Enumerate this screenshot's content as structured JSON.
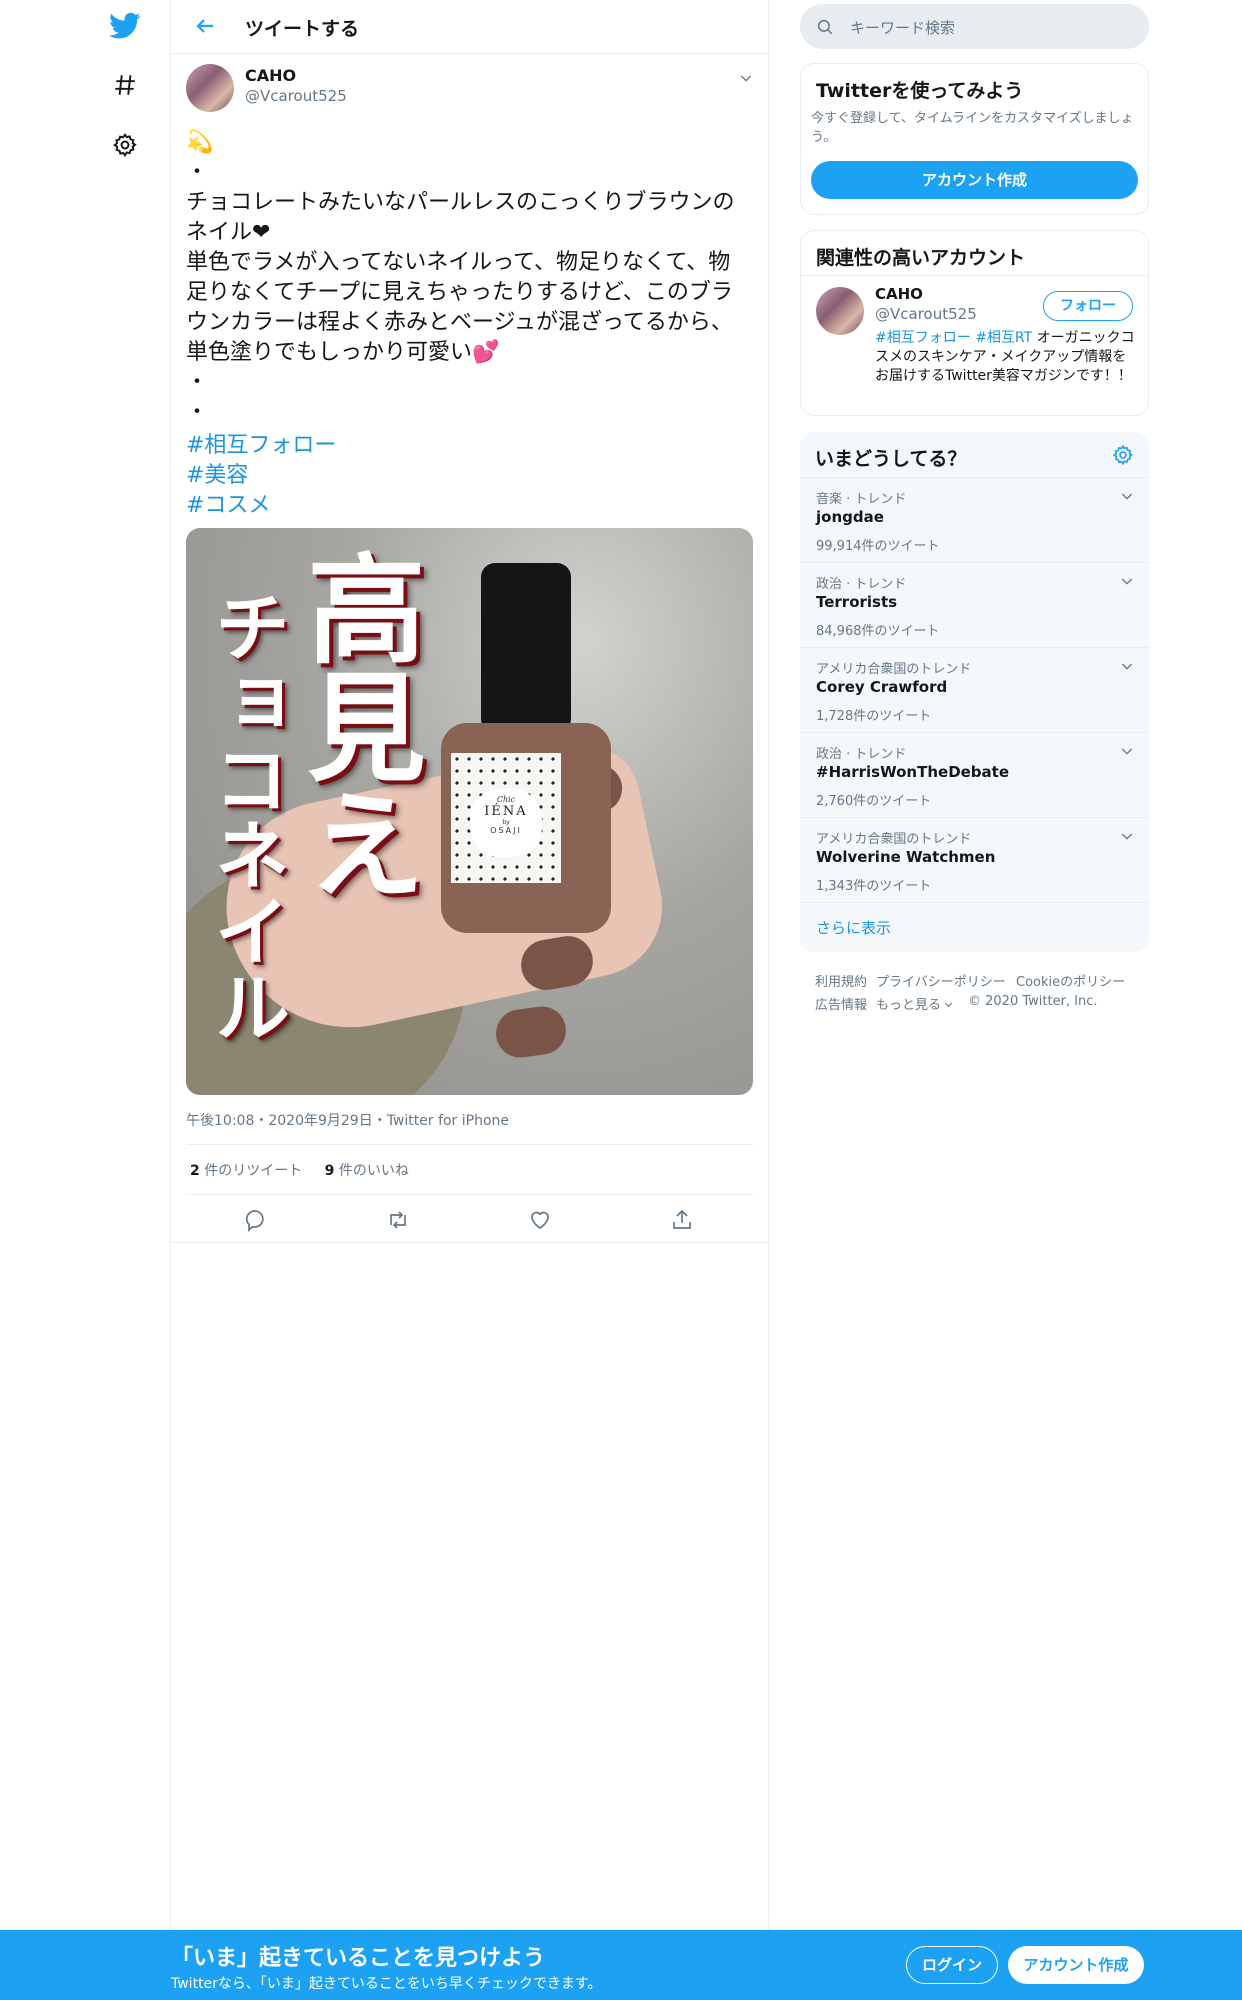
{
  "header": {
    "title": "ツイートする"
  },
  "tweet": {
    "name": "CAHO",
    "handle": "@Vcarout525",
    "body": "💫\n・\nチョコレートみたいなパールレスのこっくりブラウンのネイル❤\n単色でラメが入ってないネイルって、物足りなくて、物足りなくてチープに見えちゃったりするけど、このブラウンカラーは程よく赤みとベージュが混ざってるから、単色塗りでもしっかり可愛い💕\n・\n・",
    "hashtags": [
      "#相互フォロー",
      "#美容",
      "#コスメ"
    ],
    "photo": {
      "headline_1": "高見え",
      "headline_2": "チョコネイル",
      "bottle_brand_top": "Chic",
      "bottle_brand": "IÉNA",
      "bottle_brand_sub": "by",
      "bottle_brand_bottom": "OSAJI"
    },
    "meta": "午後10:08・2020年9月29日・Twitter for iPhone",
    "retweet_count": "2",
    "retweet_label": "件のリツイート",
    "like_count": "9",
    "like_label": "件のいいね"
  },
  "search": {
    "placeholder": "キーワード検索"
  },
  "signup_card": {
    "title": "Twitterを使ってみよう",
    "description": "今すぐ登録して、タイムラインをカスタマイズしましょう。",
    "button": "アカウント作成"
  },
  "related_card": {
    "title": "関連性の高いアカウント",
    "name": "CAHO",
    "handle": "@Vcarout525",
    "follow_button": "フォロー",
    "bio_tag_1": "#相互フォロー",
    "bio_tag_2": "#相互RT",
    "bio_rest": " オーガニックコスメのスキンケア・メイクアップ情報をお届けするTwitter美容マガジンです！！"
  },
  "trends": {
    "title": "いまどうしてる？",
    "items": [
      {
        "context": "音楽 · トレンド",
        "name": "jongdae",
        "count": "99,914件のツイート"
      },
      {
        "context": "政治 · トレンド",
        "name": "Terrorists",
        "count": "84,968件のツイート"
      },
      {
        "context": "アメリカ合衆国のトレンド",
        "name": "Corey Crawford",
        "count": "1,728件のツイート"
      },
      {
        "context": "政治 · トレンド",
        "name": "#HarrisWonTheDebate",
        "count": "2,760件のツイート"
      },
      {
        "context": "アメリカ合衆国のトレンド",
        "name": "Wolverine Watchmen",
        "count": "1,343件のツイート"
      }
    ],
    "show_more": "さらに表示"
  },
  "footer": {
    "terms": "利用規約",
    "privacy": "プライバシーポリシー",
    "cookie": "Cookieのポリシー",
    "ads": "広告情報",
    "more": "もっと見る",
    "copyright": "© 2020 Twitter, Inc."
  },
  "bottom_bar": {
    "headline": "「いま」起きていることを見つけよう",
    "sub": "Twitterなら、「いま」起きていることをいち早くチェックできます。",
    "login": "ログイン",
    "signup": "アカウント作成"
  },
  "colors": {
    "accent": "#1da1f2",
    "link": "#1b95e0",
    "border": "#e6ecf0",
    "muted": "#657786"
  }
}
